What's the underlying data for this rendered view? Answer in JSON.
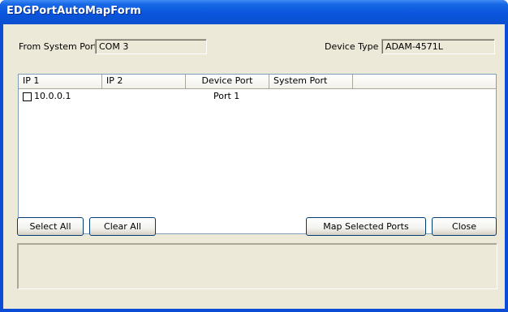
{
  "window": {
    "title": "EDGPortAutoMapForm"
  },
  "fields": {
    "from_system_port_label": "From System Port",
    "from_system_port_value": "COM 3",
    "device_type_label": "Device Type",
    "device_type_value": "ADAM-4571L"
  },
  "table": {
    "columns": [
      "IP 1",
      "IP 2",
      "Device Port",
      "System Port"
    ],
    "rows": [
      {
        "checked": false,
        "ip1": "10.0.0.1",
        "ip2": "",
        "device_port": "Port 1",
        "system_port": ""
      }
    ]
  },
  "buttons": {
    "select_all": "Select All",
    "clear_all": "Clear All",
    "map_selected_ports": "Map Selected Ports",
    "close": "Close"
  },
  "status": {
    "text": ""
  }
}
